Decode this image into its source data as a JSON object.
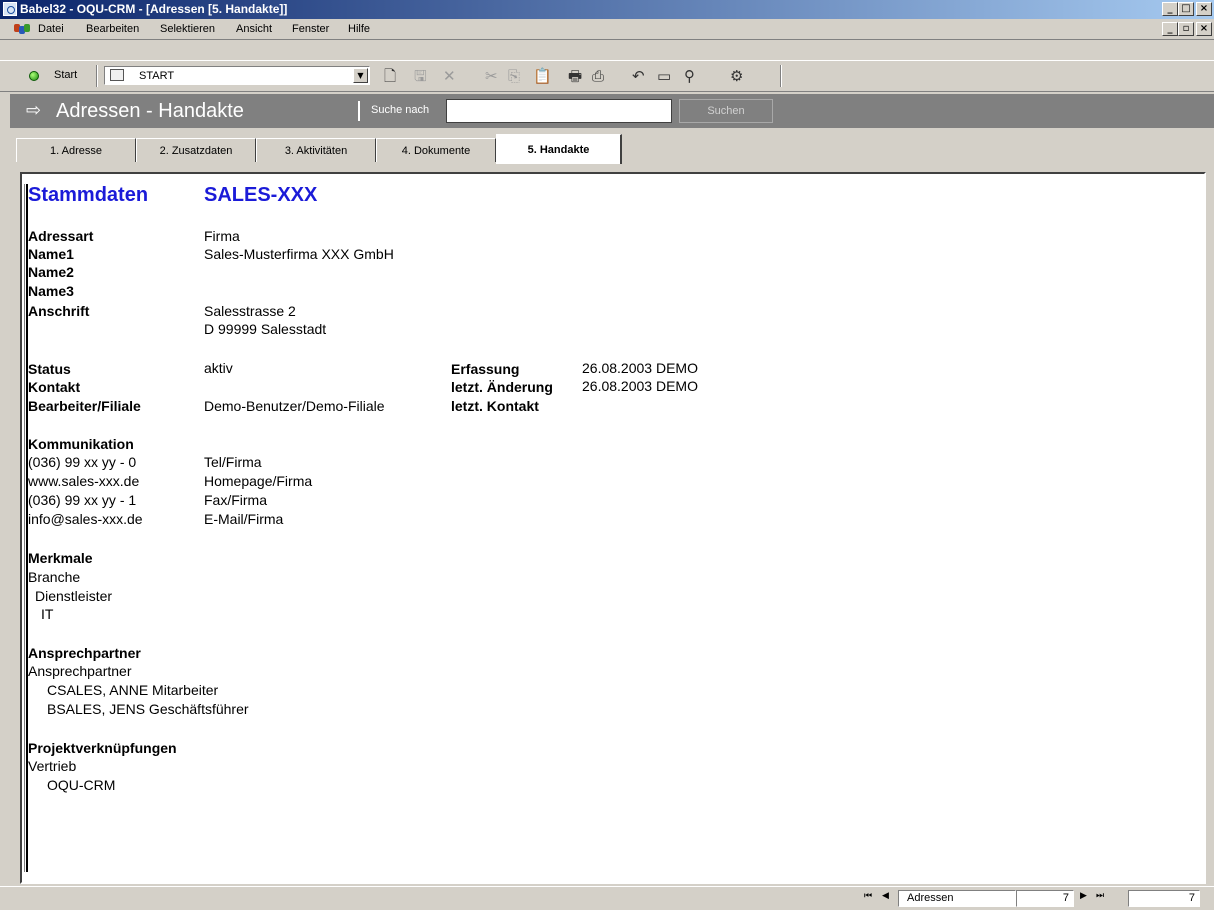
{
  "window": {
    "title": "Babel32 - OQU-CRM - [Adressen [5. Handakte]]"
  },
  "menu": [
    "Datei",
    "Bearbeiten",
    "Selektieren",
    "Ansicht",
    "Fenster",
    "Hilfe"
  ],
  "toolbar": {
    "start_label": "Start",
    "combo_value": "START"
  },
  "header": {
    "title": "Adressen - Handakte",
    "search_label": "Suche nach",
    "search_value": "",
    "search_button": "Suchen"
  },
  "tabs": [
    {
      "label": "1. Adresse"
    },
    {
      "label": "2. Zusatzdaten"
    },
    {
      "label": "3. Aktivitäten"
    },
    {
      "label": "4. Dokumente"
    },
    {
      "label": "5. Handakte",
      "active": true
    }
  ],
  "doc": {
    "heading_left": "Stammdaten",
    "heading_right": "SALES-XXX",
    "adressart_label": "Adressart",
    "adressart_value": "Firma",
    "name1_label": "Name1",
    "name1_value": "Sales-Musterfirma XXX  GmbH",
    "name2_label": "Name2",
    "name3_label": "Name3",
    "anschrift_label": "Anschrift",
    "anschrift_line1": "Salesstrasse 2",
    "anschrift_line2": "D 99999 Salesstadt",
    "status_label": "Status",
    "status_value": "aktiv",
    "kontakt_label": "Kontakt",
    "bearbeiter_label": "Bearbeiter/Filiale",
    "bearbeiter_value": "Demo-Benutzer/Demo-Filiale",
    "erfassung_label": "Erfassung",
    "erfassung_value": "26.08.2003 DEMO",
    "aenderung_label": "letzt. Änderung",
    "aenderung_value": "26.08.2003 DEMO",
    "letzt_kontakt_label": "letzt. Kontakt",
    "kommunikation_title": "Kommunikation",
    "kommunikation": [
      {
        "value": "(036) 99 xx yy - 0",
        "type": "Tel/Firma"
      },
      {
        "value": "www.sales-xxx.de",
        "type": "Homepage/Firma"
      },
      {
        "value": "(036) 99 xx yy - 1",
        "type": "Fax/Firma"
      },
      {
        "value": "info@sales-xxx.de",
        "type": "E-Mail/Firma"
      }
    ],
    "merkmale_title": "Merkmale",
    "merkmale": [
      "Branche",
      "Dienstleister",
      "IT"
    ],
    "ansprechpartner_title": "Ansprechpartner",
    "ansprechpartner_group": "Ansprechpartner",
    "ansprechpartner": [
      "CSALES, ANNE Mitarbeiter",
      "BSALES, JENS Geschäftsführer"
    ],
    "projekt_title": "Projektverknüpfungen",
    "projekt_group": "Vertrieb",
    "projekt_item": "OQU-CRM"
  },
  "statusbar": {
    "record_label": "Adressen",
    "current_record": "7",
    "total_records": "7"
  }
}
